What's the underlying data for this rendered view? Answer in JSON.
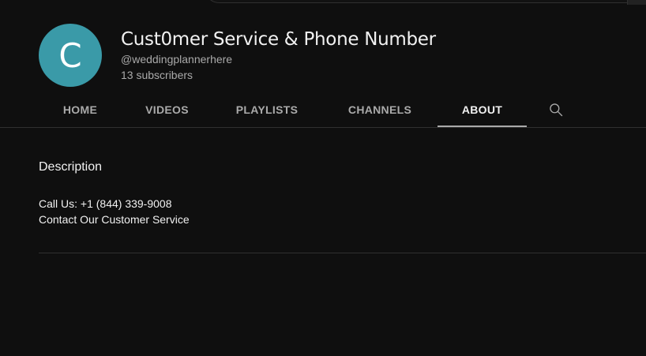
{
  "channel": {
    "avatar_letter": "C",
    "avatar_color": "#3a9aa8",
    "title": "Cust0mer Service & Phone Number",
    "handle": "@weddingplannerhere",
    "subscribers": "13 subscribers"
  },
  "tabs": [
    {
      "label": "HOME",
      "active": false
    },
    {
      "label": "VIDEOS",
      "active": false
    },
    {
      "label": "PLAYLISTS",
      "active": false
    },
    {
      "label": "CHANNELS",
      "active": false
    },
    {
      "label": "ABOUT",
      "active": true
    }
  ],
  "search_icon": "search-icon",
  "about": {
    "heading": "Description",
    "lines": [
      "Call Us: +1 (844) 339-9008",
      "Contact Our Customer Service"
    ]
  },
  "colors": {
    "background": "#0f0f0f",
    "text_primary": "#f1f1f1",
    "text_secondary": "#aaaaaa",
    "divider": "#303030"
  }
}
